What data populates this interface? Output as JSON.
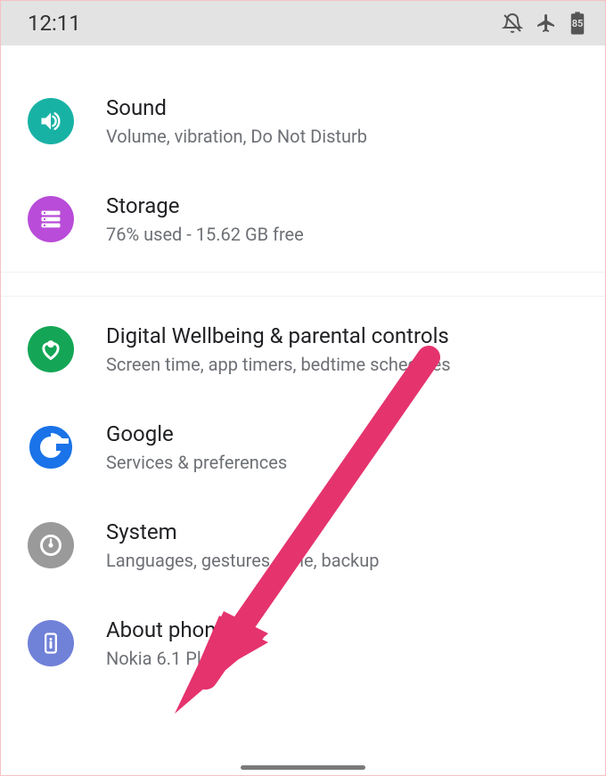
{
  "status": {
    "time": "12:11",
    "battery_label": "85"
  },
  "items": [
    {
      "icon": "volume-icon",
      "title": "Sound",
      "subtitle": "Volume, vibration, Do Not Disturb",
      "color": "#18b2a5"
    },
    {
      "icon": "storage-icon",
      "title": "Storage",
      "subtitle": "76% used - 15.62 GB free",
      "color": "#b94cd8"
    },
    {
      "icon": "wellbeing-icon",
      "title": "Digital Wellbeing & parental controls",
      "subtitle": "Screen time, app timers, bedtime schedules",
      "color": "#14a656"
    },
    {
      "icon": "google-icon",
      "title": "Google",
      "subtitle": "Services & preferences",
      "color": "#ffffff"
    },
    {
      "icon": "system-icon",
      "title": "System",
      "subtitle": "Languages, gestures, time, backup",
      "color": "#9a9a9a"
    },
    {
      "icon": "about-phone-icon",
      "title": "About phone",
      "subtitle": "Nokia 6.1 Plus",
      "color": "#7081d8"
    }
  ],
  "annotation": {
    "arrow_color": "#e5336e"
  }
}
